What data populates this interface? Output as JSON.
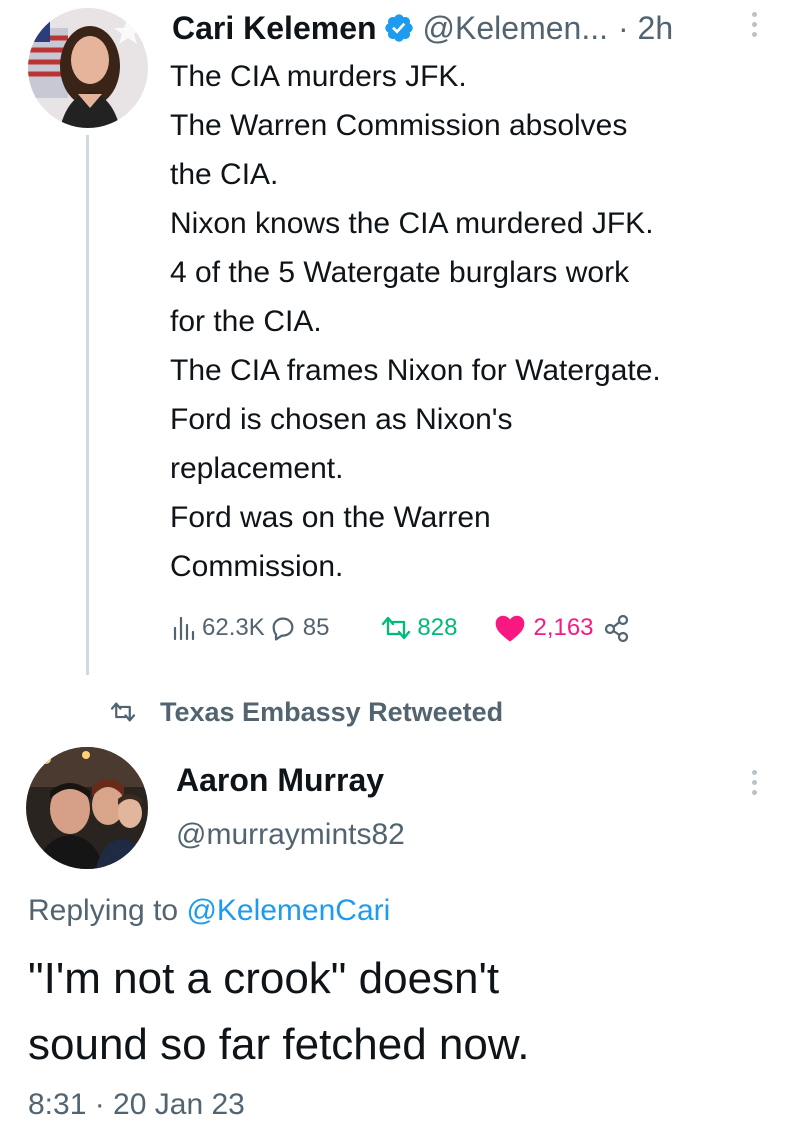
{
  "tweet1": {
    "author_name": "Cari Kelemen",
    "handle": "@Kelemen...",
    "time": "· 2h",
    "lines": [
      "The CIA murders JFK.",
      "The Warren Commission absolves",
      "the CIA.",
      "Nixon knows the CIA murdered JFK.",
      "4 of the 5 Watergate burglars work",
      "for the CIA.",
      "The CIA frames Nixon for Watergate.",
      "Ford is chosen as Nixon's",
      "replacement.",
      "Ford was on the Warren",
      "Commission."
    ],
    "stats": {
      "views": "62.3K",
      "replies": "85",
      "retweets": "828",
      "likes": "2,163"
    },
    "icons": {
      "views": "views-icon",
      "replies": "reply-icon",
      "retweets": "retweet-icon",
      "likes": "heart-icon",
      "share": "share-icon",
      "verified": "verified-badge-icon",
      "more": "more-icon"
    }
  },
  "retweet_context": {
    "label": "Texas Embassy Retweeted",
    "icon": "retweet-icon"
  },
  "tweet2": {
    "author_name": "Aaron Murray",
    "handle": "@murraymints82",
    "replying_prefix": "Replying to",
    "replying_to": "@KelemenCari",
    "lines": [
      "\"I'm not a crook\" doesn't",
      "sound so far fetched now."
    ],
    "timestamp": "8:31 · 20 Jan 23",
    "icons": {
      "more": "more-icon"
    }
  },
  "colors": {
    "text": "#0f1419",
    "secondary": "#536471",
    "link": "#1d9bf0",
    "verified": "#1d9bf0",
    "retweet": "#00ba7c",
    "like": "#f91880",
    "thread_line": "#cfd9de"
  }
}
